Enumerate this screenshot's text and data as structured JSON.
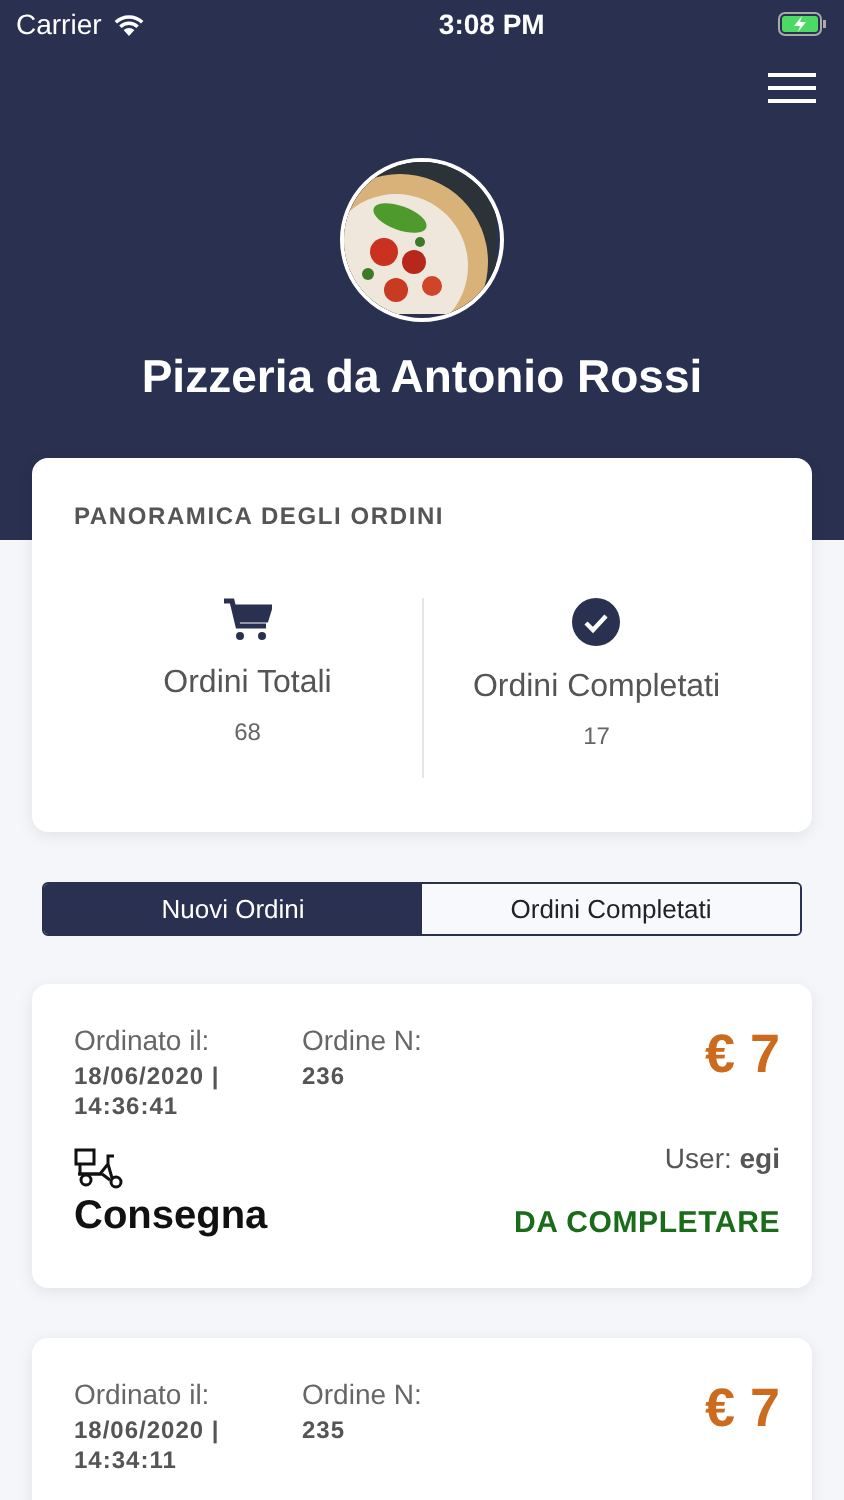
{
  "status_bar": {
    "carrier": "Carrier",
    "time": "3:08 PM"
  },
  "header": {
    "title": "Pizzeria da Antonio Rossi"
  },
  "overview": {
    "title": "PANORAMICA DEGLI ORDINI",
    "stats": [
      {
        "kind": "cart",
        "label": "Ordini Totali",
        "value": "68"
      },
      {
        "kind": "check",
        "label": "Ordini Completati",
        "value": "17"
      }
    ]
  },
  "tabs": [
    {
      "label": "Nuovi Ordini",
      "selected": true
    },
    {
      "label": "Ordini Completati",
      "selected": false
    }
  ],
  "orders": [
    {
      "date_label": "Ordinato il:",
      "date": "18/06/2020 | 14:36:41",
      "number_label": "Ordine N:",
      "number": "236",
      "price": "€ 7",
      "user": "User: **egi**",
      "delivery": "Consegna",
      "status": "DA COMPLETARE",
      "color": "#1a6b1a"
    },
    {
      "date_label": "Ordinato il:",
      "date": "18/06/2020 | 14:34:11",
      "number_label": "Ordine N:",
      "number": "235",
      "price": "€ 7"
    }
  ]
}
